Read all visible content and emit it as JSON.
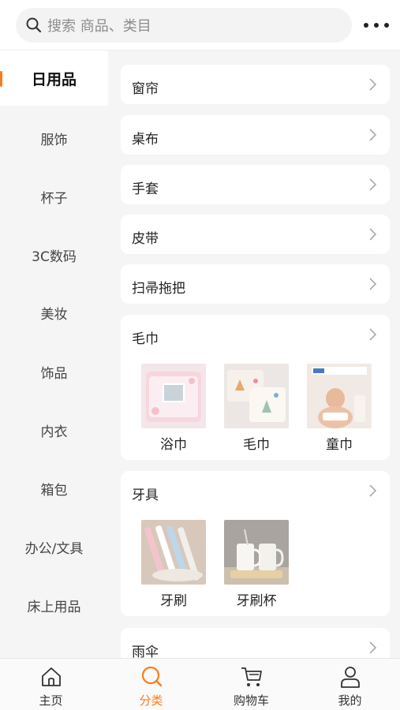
{
  "search": {
    "placeholder": "搜索 商品、类目"
  },
  "sidebar": {
    "items": [
      {
        "label": "日用品"
      },
      {
        "label": "服饰"
      },
      {
        "label": "杯子"
      },
      {
        "label": "3C数码"
      },
      {
        "label": "美妆"
      },
      {
        "label": "饰品"
      },
      {
        "label": "内衣"
      },
      {
        "label": "箱包"
      },
      {
        "label": "办公/文具"
      },
      {
        "label": "床上用品"
      }
    ]
  },
  "categories": [
    {
      "title": "窗帘"
    },
    {
      "title": "桌布"
    },
    {
      "title": "手套"
    },
    {
      "title": "皮带"
    },
    {
      "title": "扫帚拖把"
    },
    {
      "title": "毛巾",
      "items": [
        {
          "label": "浴巾"
        },
        {
          "label": "毛巾"
        },
        {
          "label": "童巾"
        }
      ]
    },
    {
      "title": "牙具",
      "items": [
        {
          "label": "牙刷"
        },
        {
          "label": "牙刷杯"
        }
      ]
    },
    {
      "title": "雨伞"
    }
  ],
  "tabbar": {
    "items": [
      {
        "label": "主页"
      },
      {
        "label": "分类"
      },
      {
        "label": "购物车"
      },
      {
        "label": "我的"
      }
    ]
  },
  "colors": {
    "accent": "#ff7a1a"
  }
}
